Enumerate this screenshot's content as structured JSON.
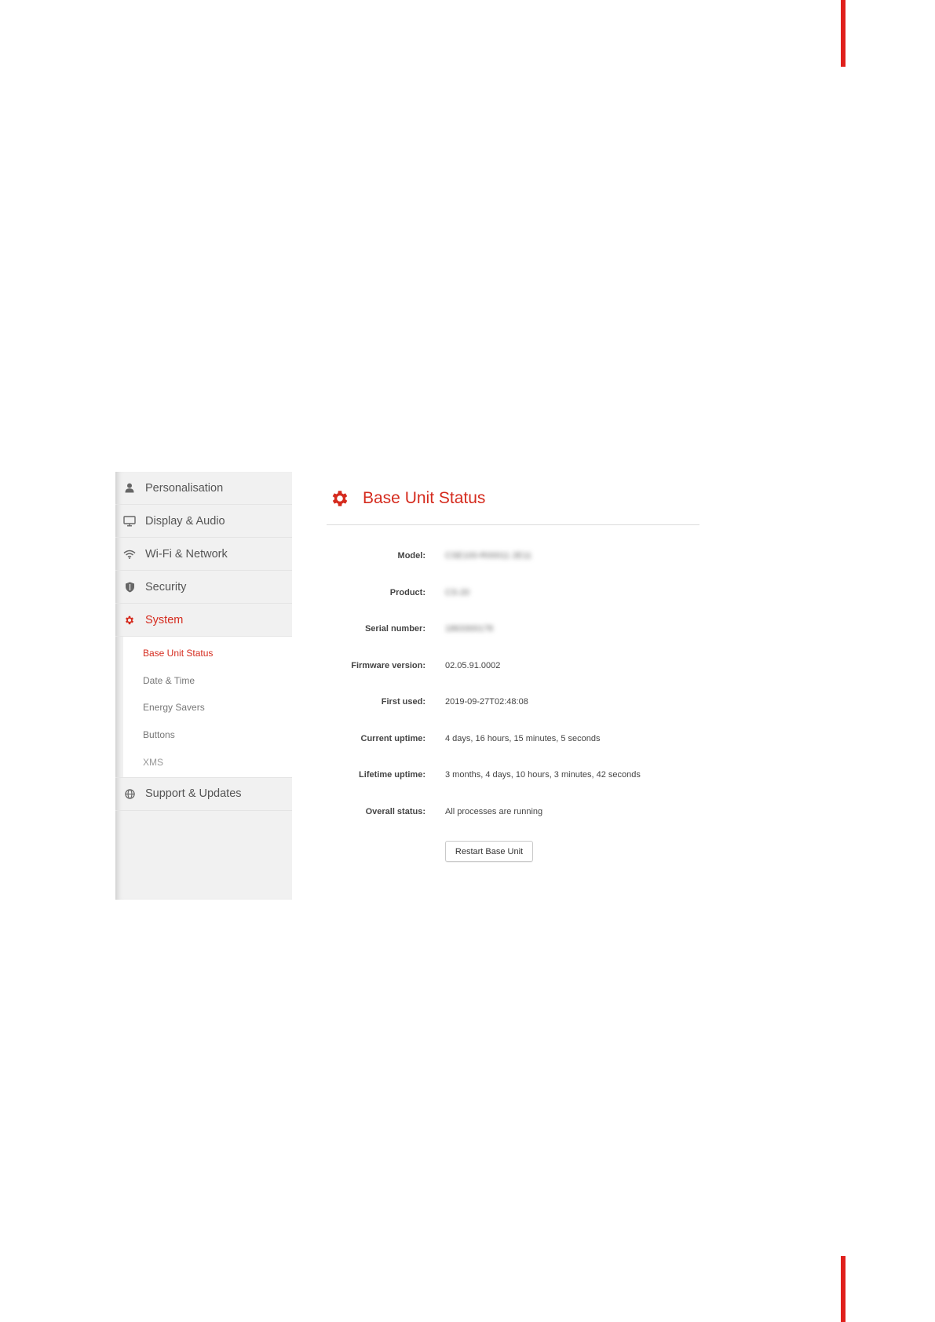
{
  "sidebar": {
    "items": [
      {
        "label": "Personalisation",
        "icon": "person-icon"
      },
      {
        "label": "Display & Audio",
        "icon": "monitor-icon"
      },
      {
        "label": "Wi-Fi & Network",
        "icon": "wifi-icon"
      },
      {
        "label": "Security",
        "icon": "shield-icon"
      },
      {
        "label": "System",
        "icon": "gear-icon",
        "active": true
      }
    ],
    "submenu": [
      {
        "label": "Base Unit Status",
        "active": true
      },
      {
        "label": "Date & Time"
      },
      {
        "label": "Energy Savers"
      },
      {
        "label": "Buttons"
      },
      {
        "label": "XMS"
      }
    ],
    "after": [
      {
        "label": "Support & Updates",
        "icon": "globe-icon"
      }
    ]
  },
  "main": {
    "title": "Base Unit Status",
    "rows": [
      {
        "label": "Model:",
        "value": "CSE100-R00011 2E11",
        "blurred": true
      },
      {
        "label": "Product:",
        "value": "CS-20",
        "blurred": true
      },
      {
        "label": "Serial number:",
        "value": "1863300178",
        "blurred": true
      },
      {
        "label": "Firmware version:",
        "value": "02.05.91.0002"
      },
      {
        "label": "First used:",
        "value": "2019-09-27T02:48:08"
      },
      {
        "label": "Current uptime:",
        "value": "4 days, 16 hours, 15 minutes, 5 seconds"
      },
      {
        "label": "Lifetime uptime:",
        "value": "3 months, 4 days, 10 hours, 3 minutes, 42 seconds"
      },
      {
        "label": "Overall status:",
        "value": "All processes are running"
      }
    ],
    "restart_label": "Restart Base Unit"
  },
  "colors": {
    "accent": "#d52b1e",
    "page_edge_bar": "#e0201c",
    "sidebar_bg": "#f1f1f1"
  }
}
